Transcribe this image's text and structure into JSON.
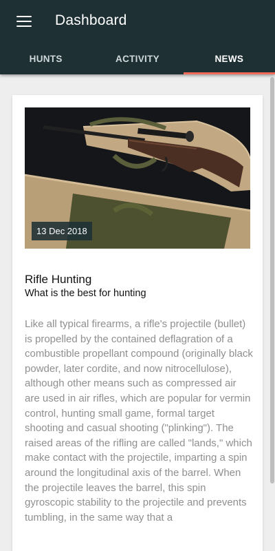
{
  "app": {
    "title": "Dashboard"
  },
  "tabs": [
    {
      "label": "HUNTS",
      "active": false
    },
    {
      "label": "ACTIVITY",
      "active": false
    },
    {
      "label": "NEWS",
      "active": true
    }
  ],
  "colors": {
    "appbar": "#1e3034",
    "tab_indicator": "#f26b5b",
    "body_text": "#8f8f8f"
  },
  "article": {
    "date": "13 Dec 2018",
    "title": "Rifle Hunting",
    "subtitle": "What is the best for hunting",
    "body": "Like all typical firearms, a rifle's projectile (bullet) is propelled by the contained deflagration of a combustible propellant compound (originally black powder, later cordite, and now nitrocellulose), although other means such as compressed air are used in air rifles, which are popular for vermin control, hunting small game, formal target shooting and casual shooting (\"plinking\"). The raised areas of the rifling are called \"lands,\" which make contact with the projectile, imparting a spin around the longitudinal axis of the barrel. When the projectile leaves the barrel, this spin gyroscopic stability to the projectile and prevents tumbling, in the same way that a"
  }
}
